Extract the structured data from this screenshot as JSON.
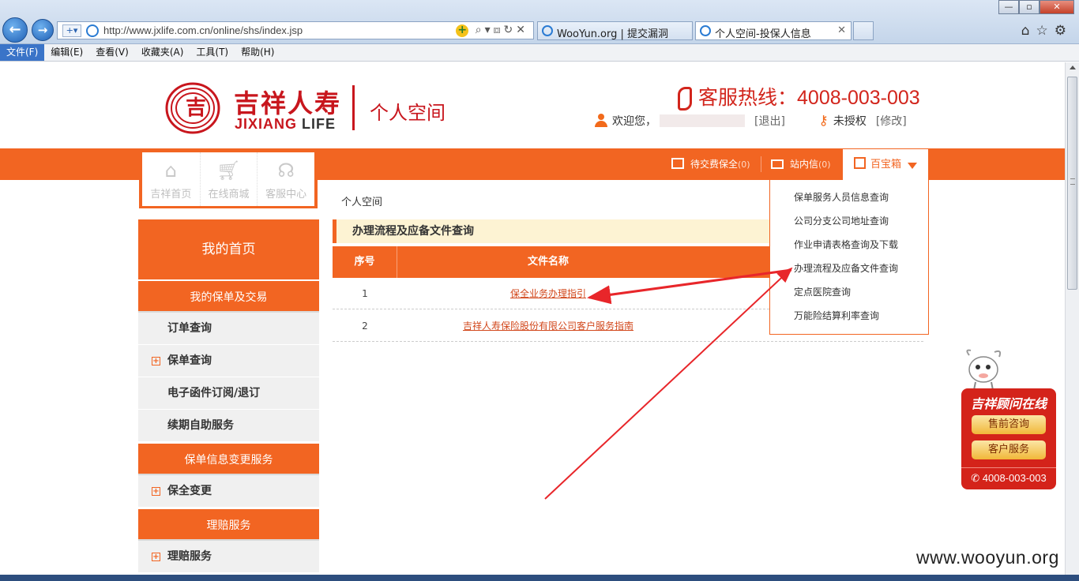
{
  "browser": {
    "url": "http://www.jxlife.com.cn/online/shs/index.jsp",
    "tabs": [
      {
        "label": "WooYun.org | 提交漏洞"
      },
      {
        "label": "个人空间-投保人信息"
      }
    ],
    "menu": [
      "文件(F)",
      "编辑(E)",
      "查看(V)",
      "收藏夹(A)",
      "工具(T)",
      "帮助(H)"
    ]
  },
  "header": {
    "brand_cn": "吉祥人寿",
    "brand_en_a": "JIXIANG",
    "brand_en_b": "LIFE",
    "title": "个人空间",
    "hotline_label": "客服热线：",
    "hotline_number": "4008-003-003",
    "welcome": "欢迎您，",
    "logout": "[退出]",
    "auth_status": "未授权",
    "modify": "[修改]"
  },
  "quicknav": [
    {
      "label": "吉祥首页",
      "icon": "home-icon"
    },
    {
      "label": "在线商城",
      "icon": "cart-icon"
    },
    {
      "label": "客服中心",
      "icon": "headset-icon"
    }
  ],
  "topnav": {
    "pending": "待交费保全",
    "pending_count": "(0)",
    "messages": "站内信",
    "messages_count": "(0)",
    "toolbox": "百宝箱"
  },
  "dropdown": [
    "保单服务人员信息查询",
    "公司分支公司地址查询",
    "作业申请表格查询及下载",
    "办理流程及应备文件查询",
    "定点医院查询",
    "万能险结算利率查询"
  ],
  "sidebar": {
    "home": "我的首页",
    "sections": [
      {
        "title": "我的保单及交易",
        "items": [
          {
            "label": "订单查询",
            "expandable": false
          },
          {
            "label": "保单查询",
            "expandable": true
          },
          {
            "label": "电子函件订阅/退订",
            "expandable": false
          },
          {
            "label": "续期自助服务",
            "expandable": false
          }
        ]
      },
      {
        "title": "保单信息变更服务",
        "items": [
          {
            "label": "保全变更",
            "expandable": true
          }
        ]
      },
      {
        "title": "理赔服务",
        "items": [
          {
            "label": "理赔服务",
            "expandable": true
          }
        ]
      }
    ]
  },
  "main": {
    "breadcrumb": "个人空间",
    "section_title": "办理流程及应备文件查询",
    "columns": [
      "序号",
      "文件名称"
    ],
    "rows": [
      {
        "no": "1",
        "name": "保全业务办理指引"
      },
      {
        "no": "2",
        "name": "吉祥人寿保险股份有限公司客户服务指南"
      }
    ]
  },
  "float_widget": {
    "title": "吉祥顾问在线",
    "presale": "售前咨询",
    "service": "客户服务",
    "phone": "4008-003-003"
  },
  "watermark": "www.wooyun.org",
  "colors": {
    "brand_orange": "#f26522",
    "brand_red": "#c8161d",
    "annotation_red": "#e8262a"
  }
}
